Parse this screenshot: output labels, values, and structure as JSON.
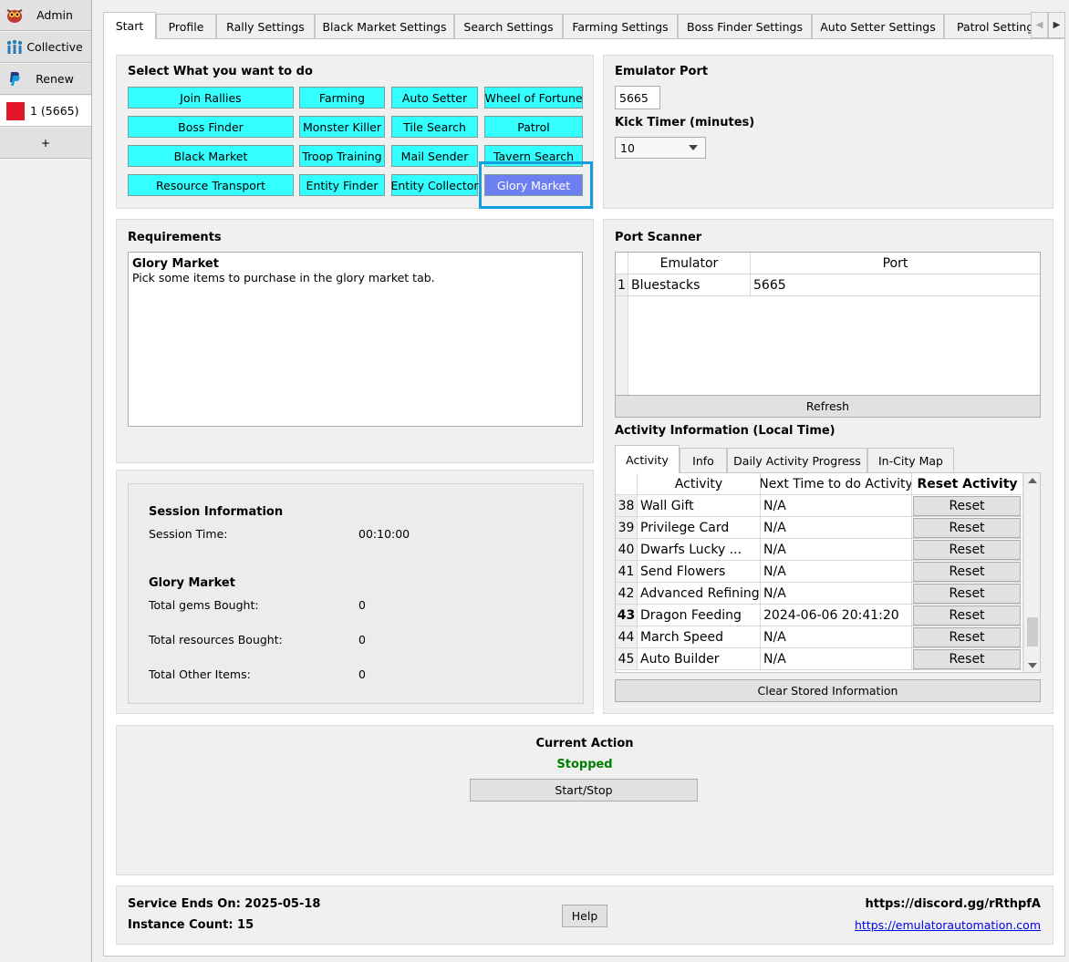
{
  "sidebar": {
    "items": [
      {
        "label": "Admin",
        "icon": "owl-logo-icon"
      },
      {
        "label": "Collective",
        "icon": "people-group-icon"
      },
      {
        "label": "Renew",
        "icon": "paypal-icon"
      },
      {
        "label": "1 (5665)",
        "icon": "red-square-icon"
      },
      {
        "label": "+"
      }
    ]
  },
  "tabs": [
    "Start",
    "Profile",
    "Rally Settings",
    "Black Market Settings",
    "Search Settings",
    "Farming Settings",
    "Boss Finder Settings",
    "Auto Setter Settings",
    "Patrol Settings"
  ],
  "actions": {
    "title": "Select What you want to do",
    "buttons": [
      "Join Rallies",
      "Farming",
      "Auto Setter",
      "Wheel of Fortune",
      "Boss Finder",
      "Monster Killer",
      "Tile Search",
      "Patrol",
      "Black Market",
      "Troop Training",
      "Mail Sender",
      "Tavern Search",
      "Resource Transport",
      "Entity Finder",
      "Entity Collector",
      "Glory Market"
    ],
    "selected": "Glory Market"
  },
  "emulator": {
    "port_label": "Emulator Port",
    "port_value": "5665",
    "kick_label": "Kick Timer (minutes)",
    "kick_value": "10"
  },
  "requirements": {
    "title": "Requirements",
    "heading": "Glory Market",
    "text": "Pick some items to purchase in the glory market tab."
  },
  "port_scanner": {
    "title": "Port Scanner",
    "columns": [
      "Emulator",
      "Port"
    ],
    "rows": [
      {
        "num": "1",
        "emulator": "Bluestacks",
        "port": "5665"
      }
    ],
    "refresh_label": "Refresh"
  },
  "activity": {
    "title": "Activity Information (Local Time)",
    "tabs": [
      "Activity",
      "Info",
      "Daily Activity Progress",
      "In-City Map"
    ],
    "columns": [
      "Activity",
      "Next Time to do Activity",
      "Reset Activity"
    ],
    "rows": [
      {
        "num": "38",
        "activity": "Wall Gift",
        "next": "N/A",
        "reset": "Reset"
      },
      {
        "num": "39",
        "activity": "Privilege Card",
        "next": "N/A",
        "reset": "Reset"
      },
      {
        "num": "40",
        "activity": "Dwarfs Lucky ...",
        "next": "N/A",
        "reset": "Reset"
      },
      {
        "num": "41",
        "activity": "Send Flowers",
        "next": "N/A",
        "reset": "Reset"
      },
      {
        "num": "42",
        "activity": "Advanced Refining",
        "next": "N/A",
        "reset": "Reset"
      },
      {
        "num": "43",
        "activity": "Dragon Feeding",
        "next": "2024-06-06 20:41:20",
        "reset": "Reset"
      },
      {
        "num": "44",
        "activity": "March Speed",
        "next": "N/A",
        "reset": "Reset"
      },
      {
        "num": "45",
        "activity": "Auto Builder",
        "next": "N/A",
        "reset": "Reset"
      }
    ],
    "clear_label": "Clear Stored Information"
  },
  "session": {
    "title": "Session Information",
    "time_label": "Session Time:",
    "time_value": "00:10:00",
    "glory_title": "Glory Market",
    "stats": [
      {
        "label": "Total gems Bought:",
        "value": "0"
      },
      {
        "label": "Total resources Bought:",
        "value": "0"
      },
      {
        "label": "Total Other Items:",
        "value": "0"
      }
    ]
  },
  "current_action": {
    "title": "Current Action",
    "status": "Stopped",
    "status_color": "#008000",
    "button_label": "Start/Stop"
  },
  "footer": {
    "service_ends": "Service Ends On: 2025-05-18",
    "instance_count": "Instance Count: 15",
    "help_label": "Help",
    "discord": "https://discord.gg/rRthpfA",
    "website": "https://emulatorautomation.com"
  },
  "colors": {
    "action_button": "#33ffff",
    "action_selected": "#6d7ef0",
    "highlight": "#139fdc"
  }
}
